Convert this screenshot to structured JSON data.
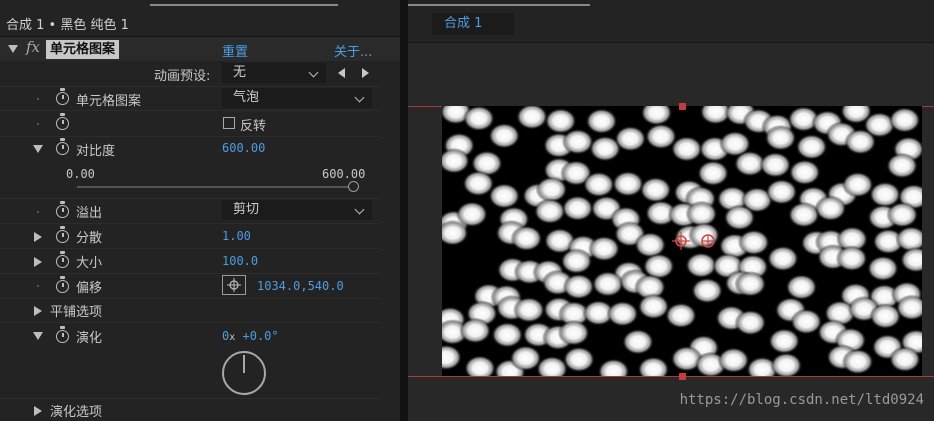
{
  "effect_controls": {
    "title": "合成 1 • 黑色 纯色 1",
    "effect": {
      "fx_label": "fx",
      "name": "单元格图案",
      "reset": "重置",
      "about": "关于..."
    },
    "animation_preset": {
      "label": "动画预设:",
      "value": "无"
    },
    "params": {
      "cell_pattern": {
        "label": "单元格图案",
        "value": "气泡"
      },
      "invert": {
        "label": "反转",
        "checked": false
      },
      "contrast": {
        "label": "对比度",
        "value": "600.00",
        "slider_min": "0.00",
        "slider_max": "600.00",
        "slider_fraction": 1.0
      },
      "overflow": {
        "label": "溢出",
        "value": "剪切"
      },
      "disperse": {
        "label": "分散",
        "value": "1.00"
      },
      "size": {
        "label": "大小",
        "value": "100.0"
      },
      "offset": {
        "label": "偏移",
        "value": "1034.0,540.0"
      },
      "tiling": {
        "label": "平铺选项"
      },
      "evolution": {
        "label": "演化",
        "value_rev": "0",
        "value_x": "x",
        "value_deg": "+0.0°"
      },
      "evolution_options": {
        "label": "演化选项"
      }
    }
  },
  "composition": {
    "tab": "合成 1"
  },
  "watermark": "https://blog.csdn.net/ltd0924",
  "colors": {
    "accent": "#4d9de0",
    "handle": "#c63b3b"
  },
  "icons": [
    "stopwatch-icon",
    "chevron-down-icon",
    "triangle-left-icon",
    "triangle-right-icon",
    "target-icon",
    "anchor-crosshair-icon"
  ]
}
